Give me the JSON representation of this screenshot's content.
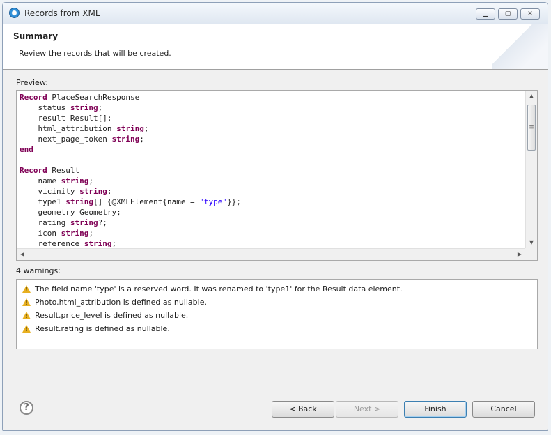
{
  "window": {
    "title": "Records from XML",
    "controls": [
      "▁",
      "▢",
      "✕"
    ]
  },
  "header": {
    "title": "Summary",
    "description": "Review the records that will be created."
  },
  "preview": {
    "label": "Preview:",
    "code": [
      [
        {
          "t": "Record",
          "c": "kw"
        },
        {
          "t": " PlaceSearchResponse"
        }
      ],
      [
        {
          "t": "    status "
        },
        {
          "t": "string",
          "c": "kw"
        },
        {
          "t": ";"
        }
      ],
      [
        {
          "t": "    result Result[];"
        }
      ],
      [
        {
          "t": "    html_attribution "
        },
        {
          "t": "string",
          "c": "kw"
        },
        {
          "t": ";"
        }
      ],
      [
        {
          "t": "    next_page_token "
        },
        {
          "t": "string",
          "c": "kw"
        },
        {
          "t": ";"
        }
      ],
      [
        {
          "t": "end",
          "c": "kw"
        }
      ],
      [],
      [
        {
          "t": "Record",
          "c": "kw"
        },
        {
          "t": " Result"
        }
      ],
      [
        {
          "t": "    name "
        },
        {
          "t": "string",
          "c": "kw"
        },
        {
          "t": ";"
        }
      ],
      [
        {
          "t": "    vicinity "
        },
        {
          "t": "string",
          "c": "kw"
        },
        {
          "t": ";"
        }
      ],
      [
        {
          "t": "    type1 "
        },
        {
          "t": "string",
          "c": "kw"
        },
        {
          "t": "[] {@XMLElement{name = "
        },
        {
          "t": "\"type\"",
          "c": "str"
        },
        {
          "t": "}};"
        }
      ],
      [
        {
          "t": "    geometry Geometry;"
        }
      ],
      [
        {
          "t": "    rating "
        },
        {
          "t": "string",
          "c": "kw"
        },
        {
          "t": "?;"
        }
      ],
      [
        {
          "t": "    icon "
        },
        {
          "t": "string",
          "c": "kw"
        },
        {
          "t": ";"
        }
      ],
      [
        {
          "t": "    reference "
        },
        {
          "t": "string",
          "c": "kw"
        },
        {
          "t": ";"
        }
      ]
    ]
  },
  "warnings": {
    "label": "4 warnings:",
    "items": [
      "The field name 'type' is a reserved word. It was renamed to 'type1' for the Result data element.",
      "Photo.html_attribution is defined as nullable.",
      "Result.price_level is defined as nullable.",
      "Result.rating is defined as nullable."
    ]
  },
  "buttons": {
    "help": "?",
    "back": "< Back",
    "next": "Next >",
    "finish": "Finish",
    "cancel": "Cancel"
  },
  "colors": {
    "keyword": "#7f0055",
    "string_literal": "#2a00ff",
    "warning_icon": "#e8b020"
  }
}
